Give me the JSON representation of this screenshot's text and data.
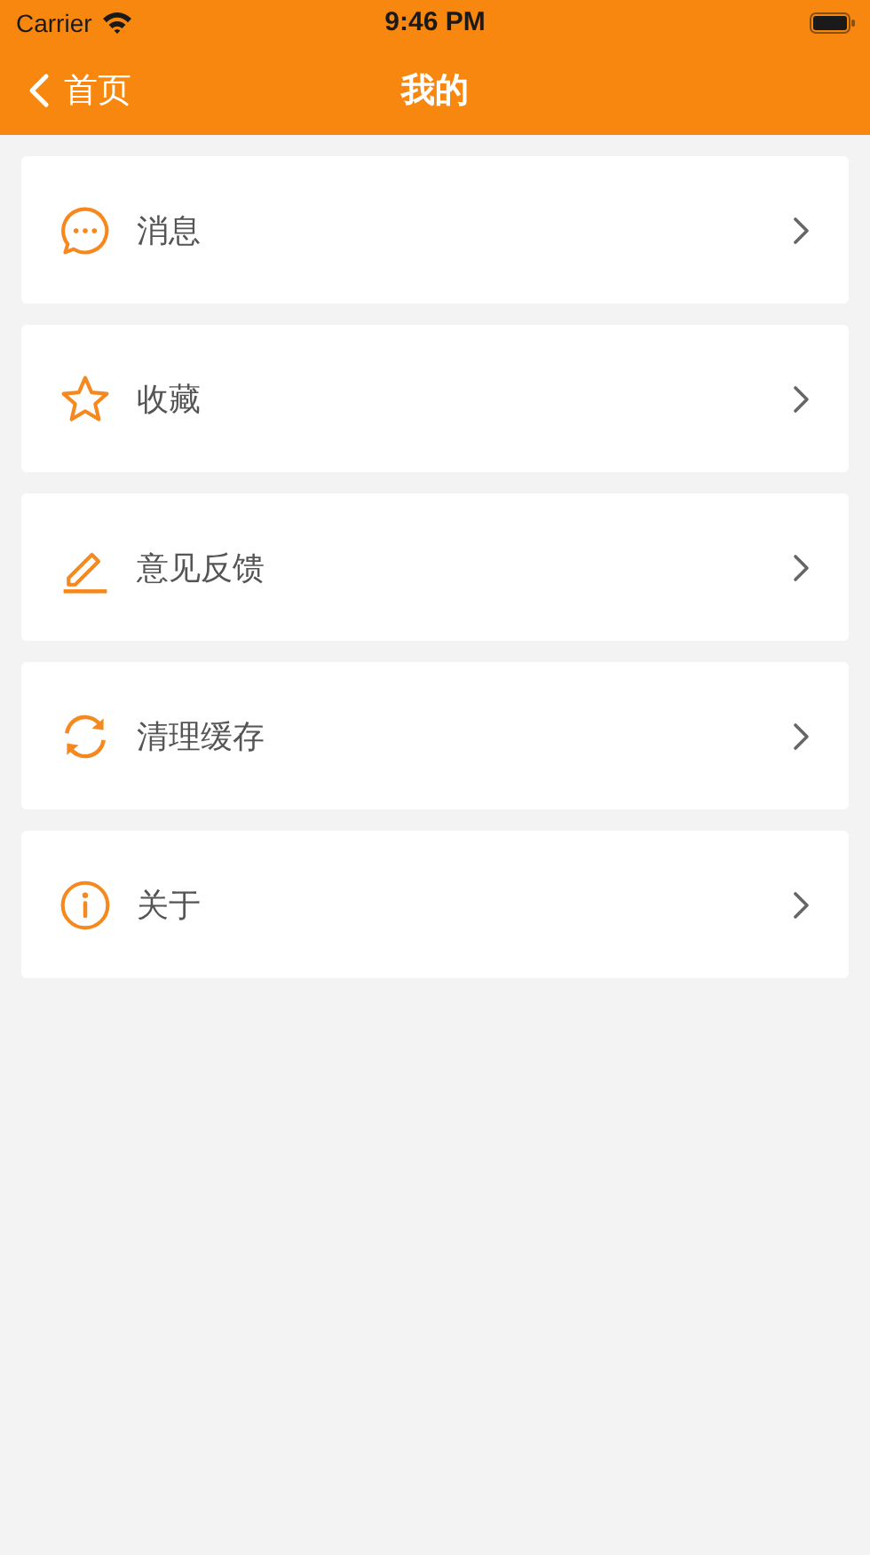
{
  "status_bar": {
    "carrier": "Carrier",
    "time": "9:46 PM"
  },
  "nav_bar": {
    "back_label": "首页",
    "title": "我的"
  },
  "menu_items": [
    {
      "kind": "message",
      "label": "消息"
    },
    {
      "kind": "star",
      "label": "收藏"
    },
    {
      "kind": "edit",
      "label": "意见反馈"
    },
    {
      "kind": "refresh",
      "label": "清理缓存"
    },
    {
      "kind": "info",
      "label": "关于"
    }
  ]
}
